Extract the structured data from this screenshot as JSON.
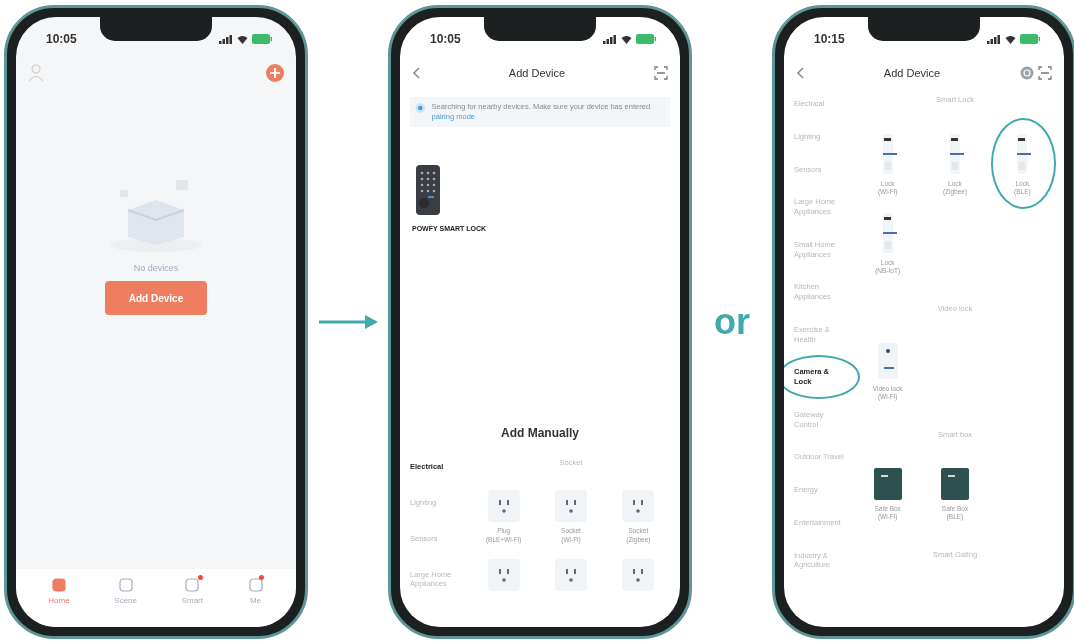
{
  "phones": [
    {
      "kind": "home",
      "time": "10:05",
      "empty_text": "No devices",
      "button": "Add Device",
      "tabs": [
        {
          "label": "Home",
          "selected": true,
          "notification": false
        },
        {
          "label": "Scene",
          "selected": false,
          "notification": false
        },
        {
          "label": "Smart",
          "selected": false,
          "notification": true
        },
        {
          "label": "Me",
          "selected": false,
          "notification": true
        }
      ]
    },
    {
      "kind": "search",
      "time": "10:05",
      "title": "Add Device",
      "notice": "Searching for nearby devices. Make sure your device has entered",
      "notice_link": "pairing mode",
      "found_device": "POWFY SMART LOCK",
      "manual_title": "Add Manually",
      "categories": [
        {
          "label": "Electrical",
          "selected": true,
          "circled": false
        },
        {
          "label": "Lighting",
          "selected": false,
          "circled": false
        },
        {
          "label": "Sensors",
          "selected": false,
          "circled": false
        },
        {
          "label": "Large Home Appliances",
          "selected": false,
          "circled": false
        }
      ],
      "sections": [
        {
          "title": "Socket",
          "items": [
            {
              "kind": "socket",
              "label": "Plug",
              "sub": "(BLE+Wi-Fi)",
              "circled": false
            },
            {
              "kind": "socket",
              "label": "Socket",
              "sub": "(Wi-Fi)",
              "circled": false
            },
            {
              "kind": "socket",
              "label": "Socket",
              "sub": "(Zigbee)",
              "circled": false
            },
            {
              "kind": "socket",
              "circled": false
            },
            {
              "kind": "socket",
              "circled": false
            },
            {
              "kind": "socket",
              "circled": false
            }
          ]
        }
      ]
    },
    {
      "kind": "category",
      "time": "10:15",
      "title": "Add Device",
      "categories": [
        {
          "label": "Electrical",
          "selected": false,
          "circled": false
        },
        {
          "label": "Lighting",
          "selected": false,
          "circled": false
        },
        {
          "label": "Sensors",
          "selected": false,
          "circled": false
        },
        {
          "label": "Large Home Appliances",
          "selected": false,
          "circled": false
        },
        {
          "label": "Small Home Appliances",
          "selected": false,
          "circled": false
        },
        {
          "label": "Kitchen Appliances",
          "selected": false,
          "circled": false
        },
        {
          "label": "Exercise & Health",
          "selected": false,
          "circled": false
        },
        {
          "label": "Camera & Lock",
          "selected": true,
          "circled": true
        },
        {
          "label": "Gateway Control",
          "selected": false,
          "circled": false
        },
        {
          "label": "Outdoor Travel",
          "selected": false,
          "circled": false
        },
        {
          "label": "Energy",
          "selected": false,
          "circled": false
        },
        {
          "label": "Entertainment",
          "selected": false,
          "circled": false
        },
        {
          "label": "Industry & Agriculture",
          "selected": false,
          "circled": false
        }
      ],
      "sections": [
        {
          "title": "Smart Lock",
          "items": [
            {
              "kind": "lock",
              "label": "Lock",
              "sub": "(Wi-Fi)",
              "circled": false
            },
            {
              "kind": "lock",
              "label": "Lock",
              "sub": "(Zigbee)",
              "circled": false
            },
            {
              "kind": "lock",
              "label": "Lock",
              "sub": "(BLE)",
              "circled": true
            },
            {
              "kind": "lock",
              "label": "Lock",
              "sub": "(NB-IoT)",
              "circled": false
            }
          ]
        },
        {
          "title": "Video lock",
          "items": [
            {
              "kind": "video_lock",
              "label": "Video lock",
              "sub": "(Wi-Fi)",
              "circled": false
            }
          ]
        },
        {
          "title": "Smart box",
          "items": [
            {
              "kind": "safe_box",
              "label": "Safe Box",
              "sub": "(Wi-Fi)",
              "circled": false
            },
            {
              "kind": "safe_box",
              "label": "Safe Box",
              "sub": "(BLE)",
              "circled": false
            }
          ]
        },
        {
          "title": "Smart Gating"
        }
      ]
    }
  ],
  "connectors": [
    {
      "kind": "arrow"
    },
    {
      "kind": "text",
      "text": "or"
    }
  ]
}
